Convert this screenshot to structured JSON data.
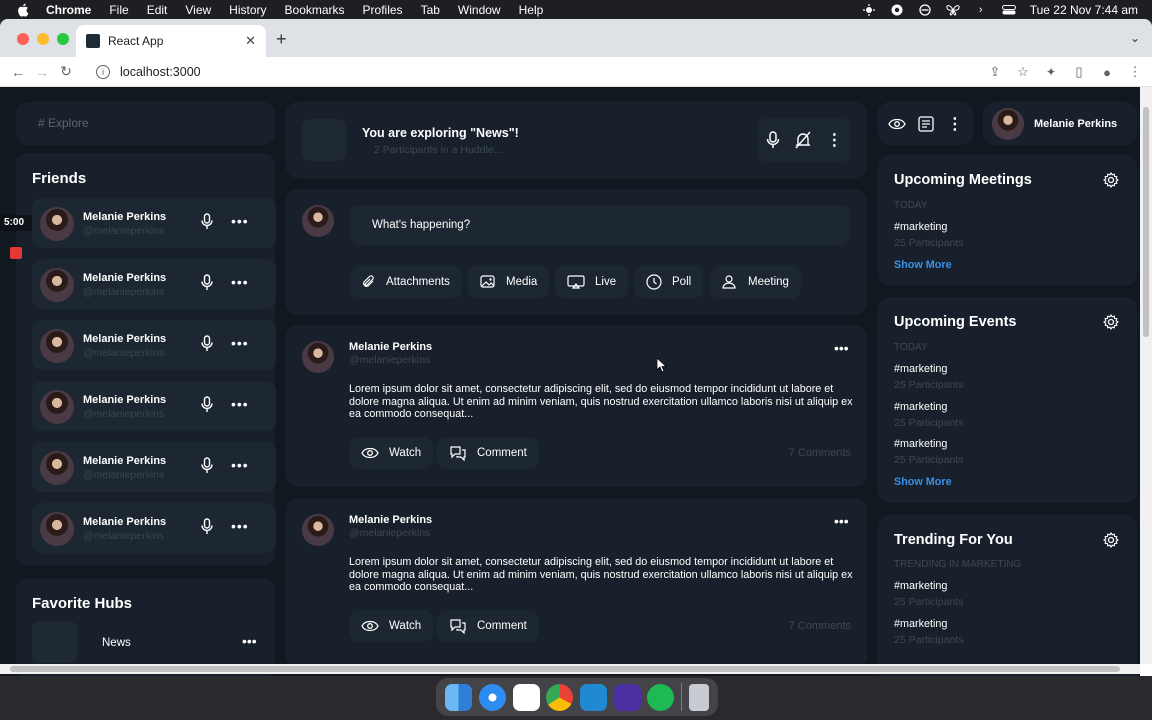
{
  "menubar": {
    "app": "Chrome",
    "items": [
      "File",
      "Edit",
      "View",
      "History",
      "Bookmarks",
      "Profiles",
      "Tab",
      "Window",
      "Help"
    ],
    "clock": "Tue 22 Nov  7:44 am"
  },
  "browser": {
    "tab_title": "React App",
    "url": "localhost:3000"
  },
  "recording": {
    "time": "5:00"
  },
  "left": {
    "explore_placeholder": "# Explore",
    "friends_title": "Friends",
    "friends": [
      {
        "name": "Melanie Perkins",
        "handle": "@melanieperkins"
      },
      {
        "name": "Melanie Perkins",
        "handle": "@melanieperkins"
      },
      {
        "name": "Melanie Perkins",
        "handle": "@melanieperkins"
      },
      {
        "name": "Melanie Perkins",
        "handle": "@melanieperkins"
      },
      {
        "name": "Melanie Perkins",
        "handle": "@melanieperkins"
      },
      {
        "name": "Melanie Perkins",
        "handle": "@melanieperkins"
      }
    ],
    "hubs_title": "Favorite Hubs",
    "hubs": [
      {
        "name": "News"
      }
    ]
  },
  "center": {
    "huddle_title": "You are exploring \"News\"!",
    "huddle_sub": "2 Participants in a Huddle...",
    "composer_placeholder": "What's happening?",
    "actions": [
      "Attachments",
      "Media",
      "Live",
      "Poll",
      "Meeting"
    ],
    "posts": [
      {
        "name": "Melanie Perkins",
        "handle": "@melanieperkins",
        "body": "Lorem ipsum dolor sit amet, consectetur adipiscing elit, sed do eiusmod tempor incididunt ut labore et dolore magna aliqua. Ut enim ad minim veniam, quis nostrud exercitation ullamco laboris nisi ut aliquip ex ea commodo consequat...",
        "watch": "Watch",
        "comment": "Comment",
        "comments": "7 Comments"
      },
      {
        "name": "Melanie Perkins",
        "handle": "@melanieperkins",
        "body": "Lorem ipsum dolor sit amet, consectetur adipiscing elit, sed do eiusmod tempor incididunt ut labore et dolore magna aliqua. Ut enim ad minim veniam, quis nostrud exercitation ullamco laboris nisi ut aliquip ex ea commodo consequat...",
        "watch": "Watch",
        "comment": "Comment",
        "comments": "7 Comments"
      }
    ]
  },
  "right": {
    "profile_name": "Melanie Perkins",
    "meetings": {
      "title": "Upcoming Meetings",
      "label": "TODAY",
      "items": [
        {
          "tag": "#marketing",
          "participants": "25 Participants"
        }
      ],
      "show_more": "Show More"
    },
    "events": {
      "title": "Upcoming Events",
      "label": "TODAY",
      "items": [
        {
          "tag": "#marketing",
          "participants": "25 Participants"
        },
        {
          "tag": "#marketing",
          "participants": "25 Participants"
        },
        {
          "tag": "#marketing",
          "participants": "25 Participants"
        }
      ],
      "show_more": "Show More"
    },
    "trending": {
      "title": "Trending For You",
      "label": "TRENDING IN MARKETING",
      "items": [
        {
          "tag": "#marketing",
          "participants": "25 Participants"
        },
        {
          "tag": "#marketing",
          "participants": "25 Participants"
        }
      ]
    }
  },
  "dock": {
    "apps": [
      "finder-icon",
      "safari-icon",
      "slack-icon",
      "chrome-icon",
      "vscode-icon",
      "obsidian-icon",
      "spotify-icon",
      "trash-icon"
    ]
  },
  "colors": {
    "app_bg": "#111820",
    "card_bg": "#18212b",
    "link": "#3a90e8",
    "muted": "#3d4853"
  }
}
